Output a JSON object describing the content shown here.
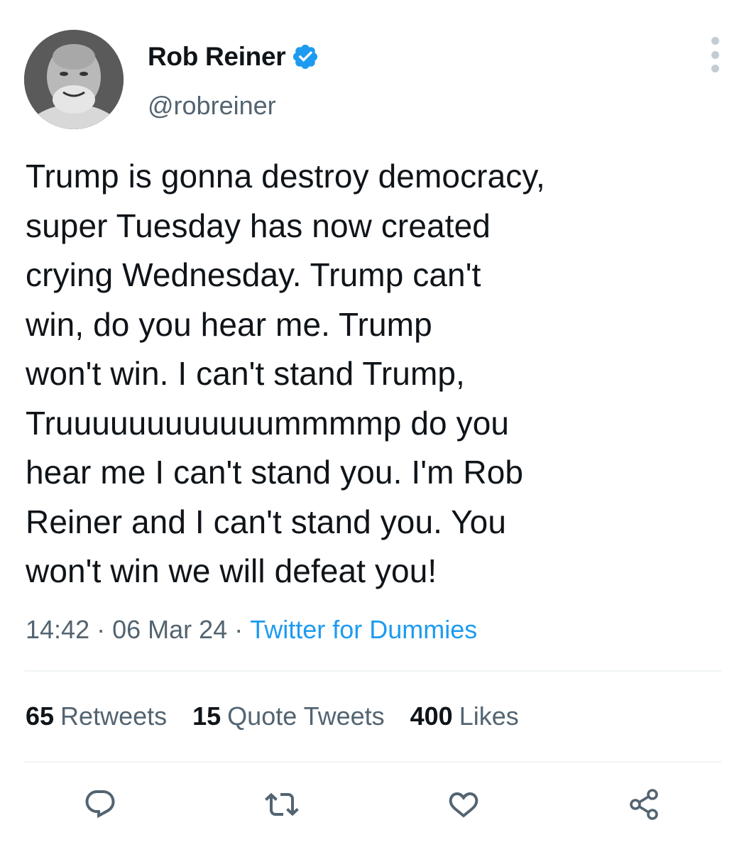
{
  "user": {
    "display_name": "Rob Reiner",
    "handle": "@robreiner",
    "verified": true,
    "verified_color": "#1d9bf0"
  },
  "tweet": {
    "text": "Trump is gonna destroy democracy,\nsuper Tuesday has now created\ncrying Wednesday. Trump can't\nwin, do you hear me. Trump\nwon't win. I can't stand Trump,\nTruuuuuuuuuuuummmmp do you\nhear me I can't stand you. I'm Rob\nReiner and I can't stand you. You\nwon't win we will defeat you!",
    "time": "14:42",
    "date": "06 Mar 24",
    "separator": "·",
    "source": "Twitter for Dummies"
  },
  "stats": {
    "retweets_count": "65",
    "retweets_label": "Retweets",
    "quotes_count": "15",
    "quotes_label": "Quote Tweets",
    "likes_count": "400",
    "likes_label": "Likes"
  },
  "actions": {
    "icons": [
      "reply-icon",
      "retweet-icon",
      "like-icon",
      "share-icon"
    ],
    "icon_color": "#536471"
  },
  "colors": {
    "text": "#0f1419",
    "secondary": "#536471",
    "link": "#1d9bf0",
    "divider": "#eff3f4"
  }
}
